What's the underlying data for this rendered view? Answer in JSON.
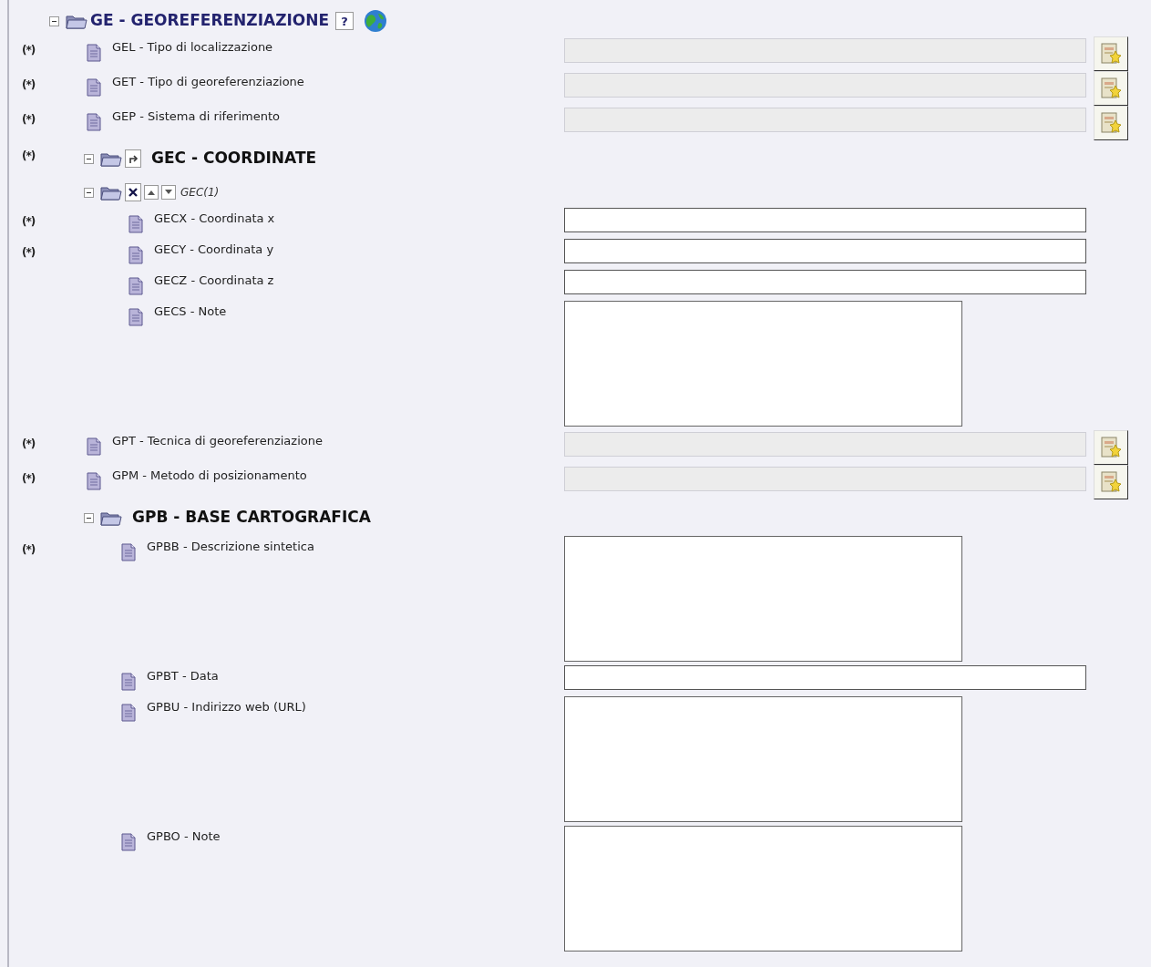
{
  "tree": [
    {
      "kind": "section",
      "title": "GE - GEOREFERENZIAZIONE",
      "expanded": true,
      "help": "?",
      "globe": true,
      "children": [
        {
          "kind": "lookup",
          "mark": "(*)",
          "label": "GEL - Tipo di localizzazione"
        },
        {
          "kind": "lookup",
          "mark": "(*)",
          "label": "GET - Tipo di georeferenziazione"
        },
        {
          "kind": "lookup",
          "mark": "(*)",
          "label": "GEP - Sistema di riferimento"
        },
        {
          "kind": "section",
          "mark": "(*)",
          "title": "GEC - COORDINATE",
          "expanded": true,
          "repeat": true,
          "children": [
            {
              "kind": "instance",
              "title": "GEC(1)",
              "expanded": true,
              "children": [
                {
                  "kind": "text",
                  "mark": "(*)",
                  "label": "GECX - Coordinata x"
                },
                {
                  "kind": "text",
                  "mark": "(*)",
                  "label": "GECY - Coordinata y"
                },
                {
                  "kind": "text",
                  "label": "GECZ - Coordinata z"
                },
                {
                  "kind": "textarea",
                  "label": "GECS - Note"
                }
              ]
            }
          ]
        },
        {
          "kind": "lookup",
          "mark": "(*)",
          "label": "GPT - Tecnica di georeferenziazione"
        },
        {
          "kind": "lookup",
          "mark": "(*)",
          "label": "GPM - Metodo di posizionamento"
        },
        {
          "kind": "section",
          "title": "GPB - BASE CARTOGRAFICA",
          "expanded": true,
          "children": [
            {
              "kind": "textarea",
              "mark": "(*)",
              "label": "GPBB - Descrizione sintetica"
            },
            {
              "kind": "text",
              "label": "GPBT - Data"
            },
            {
              "kind": "textarea",
              "label": "GPBU - Indirizzo web (URL)"
            },
            {
              "kind": "textarea",
              "label": "GPBO - Note"
            }
          ]
        }
      ]
    }
  ]
}
